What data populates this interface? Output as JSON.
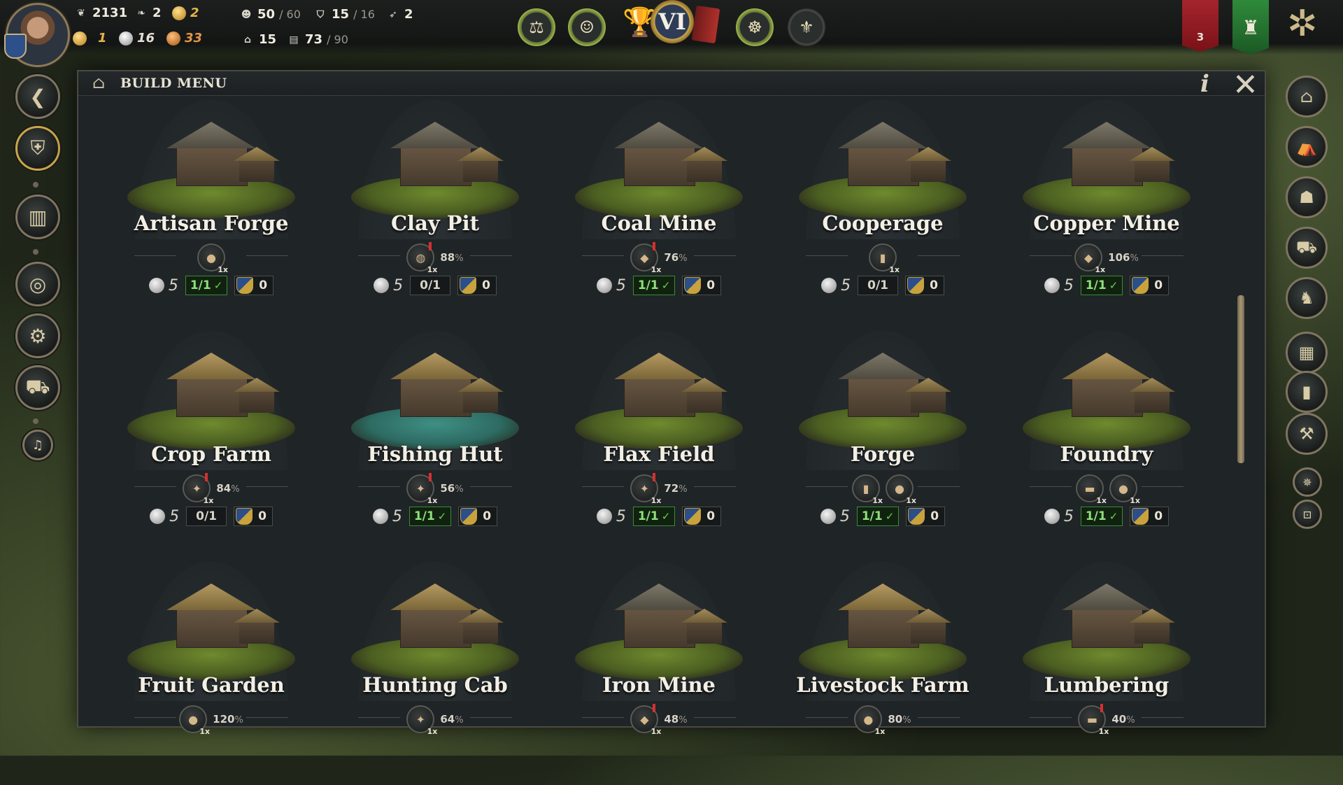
{
  "hud": {
    "stat1": "2131",
    "stat2": "2",
    "stat3": "2",
    "coins_gold": "1",
    "coins_silver": "16",
    "coins_copper": "33",
    "population": "50",
    "population_max": "/ 60",
    "housing": "15",
    "housing_max": "/ 16",
    "horn": "2",
    "building_count": "15",
    "storage": "73",
    "storage_max": "/ 90",
    "era": "VI",
    "red_banner_count": "3"
  },
  "panel": {
    "title": "BUILD MENU",
    "info_label": "i",
    "close_label": "✕"
  },
  "buildings": [
    {
      "name": "Artisan Forge",
      "prod_icons": [
        "●"
      ],
      "pct": "",
      "cost": "5",
      "slots": "1/1",
      "slots_ok": true,
      "reward": "0",
      "alert": false,
      "style": "stone"
    },
    {
      "name": "Clay Pit",
      "prod_icons": [
        "◍"
      ],
      "pct": "88",
      "cost": "5",
      "slots": "0/1",
      "slots_ok": false,
      "reward": "0",
      "alert": true,
      "style": "pit"
    },
    {
      "name": "Coal Mine",
      "prod_icons": [
        "◆"
      ],
      "pct": "76",
      "cost": "5",
      "slots": "1/1",
      "slots_ok": true,
      "reward": "0",
      "alert": true,
      "style": "mine"
    },
    {
      "name": "Cooperage",
      "prod_icons": [
        "▮"
      ],
      "pct": "",
      "cost": "5",
      "slots": "0/1",
      "slots_ok": false,
      "reward": "0",
      "alert": false,
      "style": "stone"
    },
    {
      "name": "Copper Mine",
      "prod_icons": [
        "◆"
      ],
      "pct": "106",
      "cost": "5",
      "slots": "1/1",
      "slots_ok": true,
      "reward": "0",
      "alert": false,
      "style": "mine"
    },
    {
      "name": "Crop Farm",
      "prod_icons": [
        "✦"
      ],
      "pct": "84",
      "cost": "5",
      "slots": "0/1",
      "slots_ok": false,
      "reward": "0",
      "alert": true,
      "style": "farm"
    },
    {
      "name": "Fishing Hut",
      "prod_icons": [
        "✦"
      ],
      "pct": "56",
      "cost": "5",
      "slots": "1/1",
      "slots_ok": true,
      "reward": "0",
      "alert": true,
      "style": "water"
    },
    {
      "name": "Flax Field",
      "prod_icons": [
        "✦"
      ],
      "pct": "72",
      "cost": "5",
      "slots": "1/1",
      "slots_ok": true,
      "reward": "0",
      "alert": true,
      "style": "farm"
    },
    {
      "name": "Forge",
      "prod_icons": [
        "▮",
        "●"
      ],
      "pct": "",
      "cost": "5",
      "slots": "1/1",
      "slots_ok": true,
      "reward": "0",
      "alert": false,
      "style": "stone"
    },
    {
      "name": "Foundry",
      "prod_icons": [
        "▬",
        "●"
      ],
      "pct": "",
      "cost": "5",
      "slots": "1/1",
      "slots_ok": true,
      "reward": "0",
      "alert": false,
      "style": "farm"
    },
    {
      "name": "Fruit Garden",
      "prod_icons": [
        "●"
      ],
      "pct": "120",
      "cost": "",
      "slots": "",
      "slots_ok": false,
      "reward": "",
      "alert": false,
      "style": "farm"
    },
    {
      "name": "Hunting Cab",
      "prod_icons": [
        "✦"
      ],
      "pct": "64",
      "cost": "",
      "slots": "",
      "slots_ok": false,
      "reward": "",
      "alert": false,
      "style": "farm"
    },
    {
      "name": "Iron Mine",
      "prod_icons": [
        "◆"
      ],
      "pct": "48",
      "cost": "",
      "slots": "",
      "slots_ok": false,
      "reward": "",
      "alert": true,
      "style": "mine"
    },
    {
      "name": "Livestock Farm",
      "prod_icons": [
        "●"
      ],
      "pct": "80",
      "cost": "",
      "slots": "",
      "slots_ok": false,
      "reward": "",
      "alert": false,
      "style": "farm"
    },
    {
      "name": "Lumbering",
      "prod_icons": [
        "▬"
      ],
      "pct": "40",
      "cost": "",
      "slots": "",
      "slots_ok": false,
      "reward": "",
      "alert": true,
      "style": "stone"
    }
  ],
  "colors": {
    "accent_green": "#8fe07a",
    "panel_bg": "#1f2427",
    "alert_red": "#d62f2f"
  }
}
